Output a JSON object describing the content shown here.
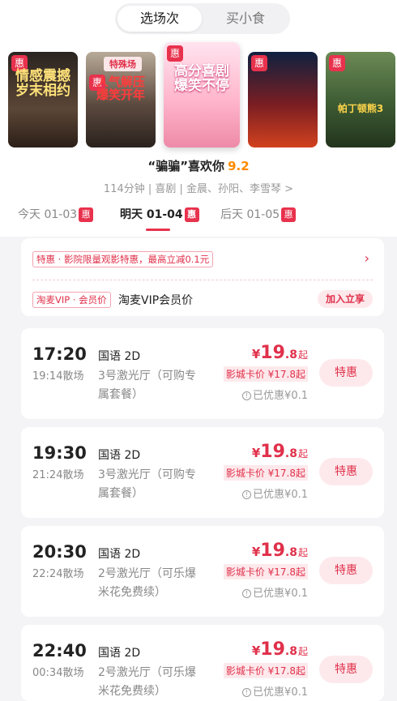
{
  "tabs": {
    "active": "选场次",
    "inactive": "买小食"
  },
  "posters": [
    {
      "badge": "惠",
      "title": "情感震撼 岁末相约"
    },
    {
      "badge": "惠",
      "ribbon": "特殊场",
      "title": "人气解压 爆笑开年"
    },
    {
      "badge": "惠",
      "title": "高分喜剧 爆笑不停"
    },
    {
      "badge": "惠",
      "title": ""
    },
    {
      "badge": "惠",
      "title": "帕丁顿熊3"
    }
  ],
  "movie": {
    "title": "“骗骗”喜欢你",
    "score": "9.2",
    "meta": "114分钟 | 喜剧 | 金晨、孙阳、李雪琴 >"
  },
  "dates": [
    {
      "label": "今天 01-03",
      "badge": "惠"
    },
    {
      "label": "明天 01-04",
      "badge": "惠"
    },
    {
      "label": "后天 01-05",
      "badge": "惠"
    }
  ],
  "promo": {
    "tag": "特惠 · 影院限量观影特惠，最高立减0.1元",
    "chevron": "›",
    "vip_tag": "淘麦VIP · 会员价",
    "vip_label": "淘麦VIP会员价",
    "vip_button": "加入立享"
  },
  "showtimes": [
    {
      "time": "17:20",
      "end": "19:14散场",
      "lang": "国语 2D",
      "hall": "3号激光厅（可购专属套餐）",
      "yen": "¥",
      "price_int": "19",
      "price_dec": ".8",
      "qi": "起",
      "card": "影城卡价 ¥17.8起",
      "saved": "已优惠¥0.1",
      "button": "特惠"
    },
    {
      "time": "19:30",
      "end": "21:24散场",
      "lang": "国语 2D",
      "hall": "3号激光厅（可购专属套餐）",
      "yen": "¥",
      "price_int": "19",
      "price_dec": ".8",
      "qi": "起",
      "card": "影城卡价 ¥17.8起",
      "saved": "已优惠¥0.1",
      "button": "特惠"
    },
    {
      "time": "20:30",
      "end": "22:24散场",
      "lang": "国语 2D",
      "hall": "2号激光厅（可乐爆米花免费续）",
      "yen": "¥",
      "price_int": "19",
      "price_dec": ".8",
      "qi": "起",
      "card": "影城卡价 ¥17.8起",
      "saved": "已优惠¥0.1",
      "button": "特惠"
    },
    {
      "time": "22:40",
      "end": "00:34散场",
      "lang": "国语 2D",
      "hall": "2号激光厅（可乐爆米花免费续）",
      "yen": "¥",
      "price_int": "19",
      "price_dec": ".8",
      "qi": "起",
      "card": "影城卡价 ¥17.8起",
      "saved": "已优惠¥0.1",
      "button": "特惠"
    }
  ],
  "colors": {
    "accent": "#e8324d",
    "score": "#ff8a00",
    "background": "#f4f4f6"
  },
  "icons": {
    "info": "info-circle-icon",
    "chevron": "chevron-right-icon"
  }
}
